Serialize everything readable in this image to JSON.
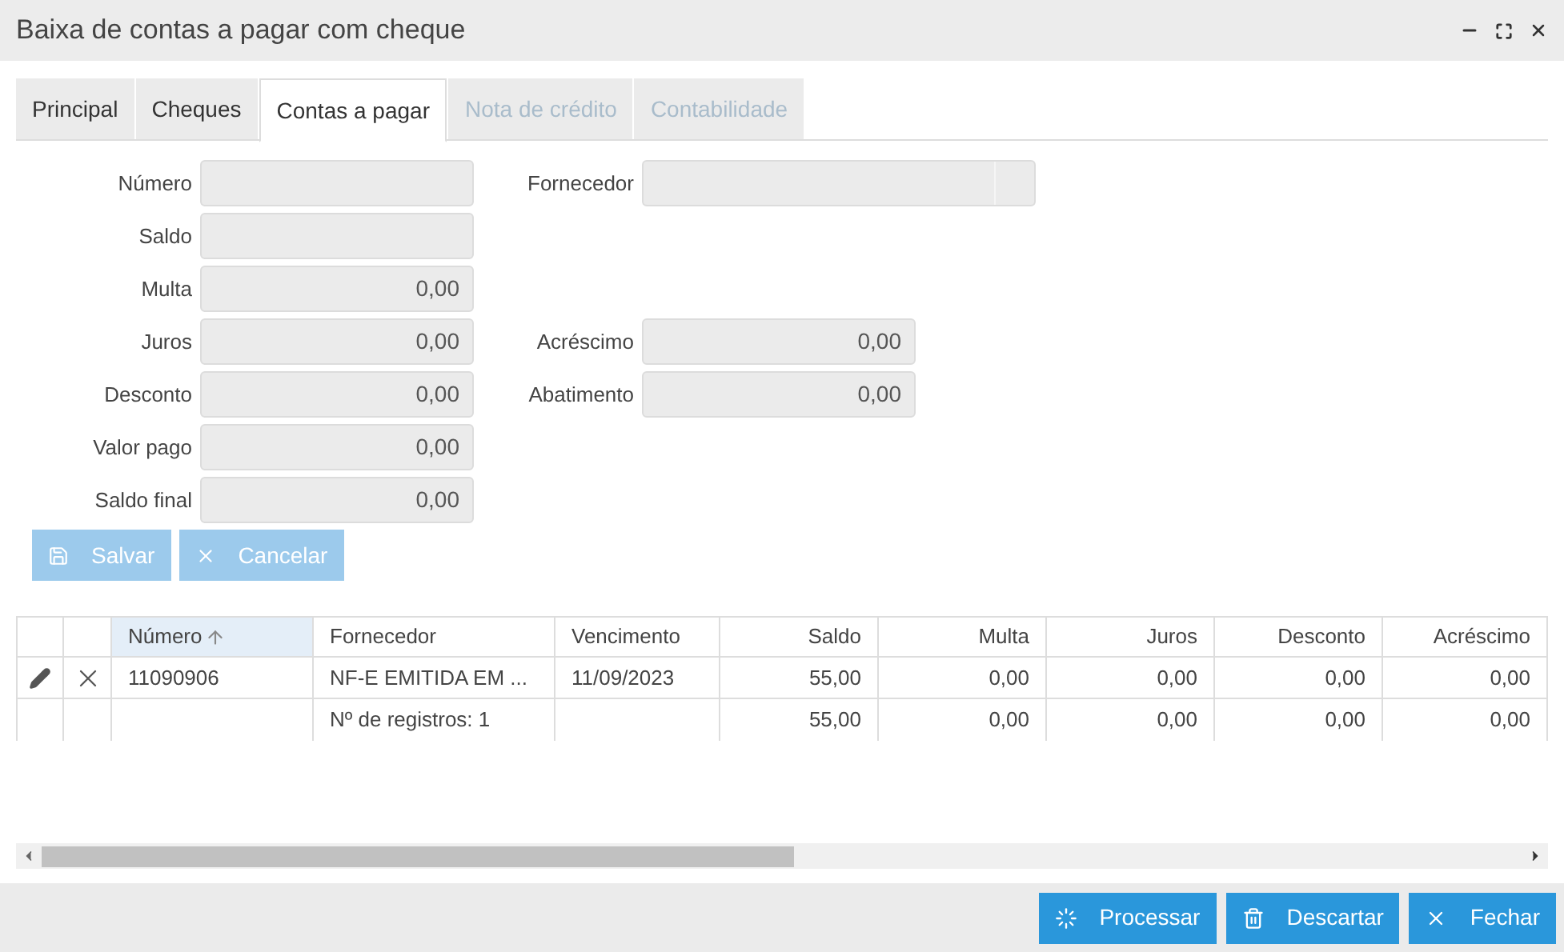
{
  "window": {
    "title": "Baixa de contas a pagar com cheque"
  },
  "tabs": [
    {
      "label": "Principal",
      "selected": false,
      "disabled": false
    },
    {
      "label": "Cheques",
      "selected": false,
      "disabled": false
    },
    {
      "label": "Contas a pagar",
      "selected": true,
      "disabled": false
    },
    {
      "label": "Nota de crédito",
      "selected": false,
      "disabled": true
    },
    {
      "label": "Contabilidade",
      "selected": false,
      "disabled": true
    }
  ],
  "form_rows": [
    {
      "left": {
        "label": "Número"
      },
      "right": {
        "label": "Fornecedor",
        "kind": "lookup"
      }
    },
    {
      "left": {
        "label": "Saldo"
      }
    },
    {
      "left": {
        "label": "Multa",
        "value": "0,00"
      }
    },
    {
      "left": {
        "label": "Juros",
        "value": "0,00"
      },
      "right": {
        "label": "Acréscimo",
        "value": "0,00",
        "kind": "number"
      }
    },
    {
      "left": {
        "label": "Desconto",
        "value": "0,00"
      },
      "right": {
        "label": "Abatimento",
        "value": "0,00",
        "kind": "number"
      }
    },
    {
      "left": {
        "label": "Valor pago",
        "value": "0,00"
      }
    },
    {
      "left": {
        "label": "Saldo final",
        "value": "0,00"
      }
    }
  ],
  "form_buttons": [
    {
      "label": "Salvar",
      "disabled": true
    },
    {
      "label": "Cancelar",
      "disabled": true
    }
  ],
  "table": {
    "columns": [
      {
        "label": "Número",
        "sorted": true
      },
      {
        "label": "Fornecedor",
        "sorted": false
      },
      {
        "label": "Vencimento",
        "sorted": false
      },
      {
        "label": "Saldo",
        "sorted": false
      },
      {
        "label": "Multa",
        "sorted": false
      },
      {
        "label": "Juros",
        "sorted": false
      },
      {
        "label": "Desconto",
        "sorted": false
      },
      {
        "label": "Acréscimo",
        "sorted": false
      }
    ],
    "rows": [
      {
        "cells": [
          "11090906",
          "NF-E EMITIDA EM ...",
          "11/09/2023",
          "55,00",
          "0,00",
          "0,00",
          "0,00",
          "0,00"
        ]
      }
    ],
    "summary": {
      "count": "Nº de registros: 1",
      "totals": [
        "55,00",
        "0,00",
        "0,00",
        "0,00",
        "0,00"
      ]
    }
  },
  "footer_buttons": [
    {
      "label": "Processar"
    },
    {
      "label": "Descartar"
    },
    {
      "label": "Fechar"
    }
  ]
}
